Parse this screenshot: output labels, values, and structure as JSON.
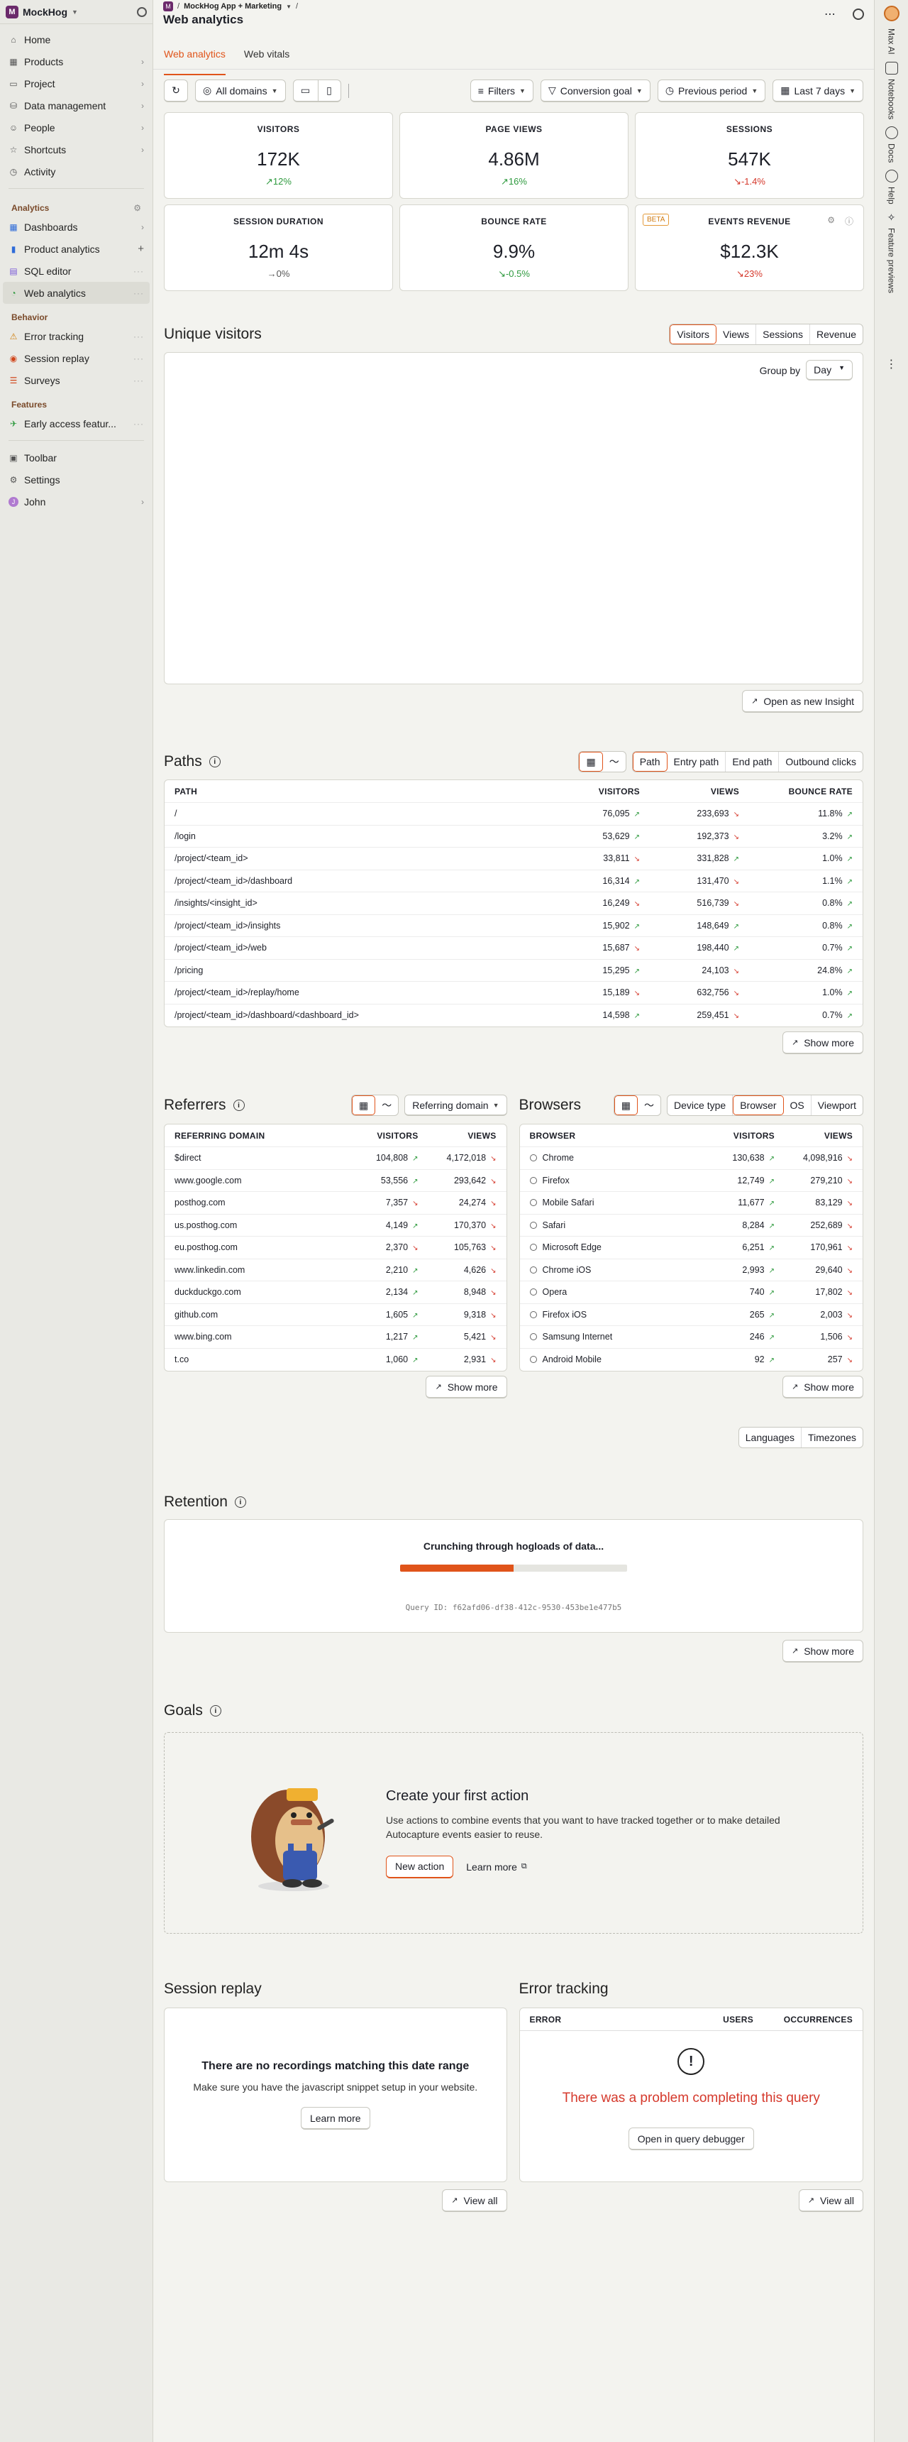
{
  "sidebar": {
    "org": "MockHog",
    "items": [
      {
        "label": "Home",
        "icon": "home-icon"
      },
      {
        "label": "Products",
        "icon": "grid-icon"
      },
      {
        "label": "Project",
        "icon": "folder-icon"
      },
      {
        "label": "Data management",
        "icon": "database-icon"
      },
      {
        "label": "People",
        "icon": "people-icon"
      },
      {
        "label": "Shortcuts",
        "icon": "bookmark-icon"
      },
      {
        "label": "Activity",
        "icon": "clock-icon"
      }
    ],
    "analytics_label": "Analytics",
    "analytics": [
      {
        "label": "Dashboards"
      },
      {
        "label": "Product analytics"
      },
      {
        "label": "SQL editor"
      },
      {
        "label": "Web analytics"
      }
    ],
    "behavior_label": "Behavior",
    "behavior": [
      {
        "label": "Error tracking"
      },
      {
        "label": "Session replay"
      },
      {
        "label": "Surveys"
      }
    ],
    "features_label": "Features",
    "features": [
      {
        "label": "Early access featur..."
      }
    ],
    "bottom": [
      {
        "label": "Toolbar"
      },
      {
        "label": "Settings"
      },
      {
        "label": "John"
      }
    ]
  },
  "rightbar": {
    "items": [
      "Max AI",
      "Notebooks",
      "Docs",
      "Help",
      "Feature previews"
    ]
  },
  "header": {
    "project": "MockHog App + Marketing",
    "title": "Web analytics"
  },
  "tabs": [
    "Web analytics",
    "Web vitals"
  ],
  "filters": {
    "domains": "All domains",
    "filters": "Filters",
    "conversion": "Conversion goal",
    "compare": "Previous period",
    "date": "Last 7 days"
  },
  "metrics": [
    {
      "label": "VISITORS",
      "value": "172K",
      "change": "↗12%",
      "trend": "up"
    },
    {
      "label": "PAGE VIEWS",
      "value": "4.86M",
      "change": "↗16%",
      "trend": "up"
    },
    {
      "label": "SESSIONS",
      "value": "547K",
      "change": "↘-1.4%",
      "trend": "down"
    },
    {
      "label": "SESSION DURATION",
      "value": "12m 4s",
      "change": "→0%",
      "trend": "flat"
    },
    {
      "label": "BOUNCE RATE",
      "value": "9.9%",
      "change": "↘-0.5%",
      "trend": "up"
    },
    {
      "label": "EVENTS REVENUE",
      "value": "$12.3K",
      "change": "↘23%",
      "trend": "down",
      "badge": "BETA"
    }
  ],
  "unique": {
    "title": "Unique visitors",
    "tabs": [
      "Visitors",
      "Views",
      "Sessions",
      "Revenue"
    ],
    "groupby_label": "Group by",
    "groupby_value": "Day",
    "open_insight": "Open as new Insight"
  },
  "paths": {
    "title": "Paths",
    "tabs": [
      "Path",
      "Entry path",
      "End path",
      "Outbound clicks"
    ],
    "headers": [
      "PATH",
      "VISITORS",
      "VIEWS",
      "BOUNCE RATE"
    ],
    "rows": [
      {
        "path": "/",
        "visitors": "76,095",
        "vt": "up",
        "views": "233,693",
        "wt": "down",
        "bounce": "11.8%",
        "bt": "up"
      },
      {
        "path": "/login",
        "visitors": "53,629",
        "vt": "up",
        "views": "192,373",
        "wt": "down",
        "bounce": "3.2%",
        "bt": "up"
      },
      {
        "path": "/project/<team_id>",
        "visitors": "33,811",
        "vt": "down",
        "views": "331,828",
        "wt": "up",
        "bounce": "1.0%",
        "bt": "up"
      },
      {
        "path": "/project/<team_id>/dashboard",
        "visitors": "16,314",
        "vt": "up",
        "views": "131,470",
        "wt": "down",
        "bounce": "1.1%",
        "bt": "up"
      },
      {
        "path": "/insights/<insight_id>",
        "visitors": "16,249",
        "vt": "down",
        "views": "516,739",
        "wt": "down",
        "bounce": "0.8%",
        "bt": "up"
      },
      {
        "path": "/project/<team_id>/insights",
        "visitors": "15,902",
        "vt": "up",
        "views": "148,649",
        "wt": "up",
        "bounce": "0.8%",
        "bt": "up"
      },
      {
        "path": "/project/<team_id>/web",
        "visitors": "15,687",
        "vt": "down",
        "views": "198,440",
        "wt": "up",
        "bounce": "0.7%",
        "bt": "up"
      },
      {
        "path": "/pricing",
        "visitors": "15,295",
        "vt": "up",
        "views": "24,103",
        "wt": "down",
        "bounce": "24.8%",
        "bt": "up"
      },
      {
        "path": "/project/<team_id>/replay/home",
        "visitors": "15,189",
        "vt": "down",
        "views": "632,756",
        "wt": "down",
        "bounce": "1.0%",
        "bt": "up"
      },
      {
        "path": "/project/<team_id>/dashboard/<dashboard_id>",
        "visitors": "14,598",
        "vt": "up",
        "views": "259,451",
        "wt": "down",
        "bounce": "0.7%",
        "bt": "up"
      }
    ],
    "show_more": "Show more"
  },
  "referrers": {
    "title": "Referrers",
    "select": "Referring domain",
    "headers": [
      "REFERRING DOMAIN",
      "VISITORS",
      "VIEWS"
    ],
    "rows": [
      {
        "name": "$direct",
        "visitors": "104,808",
        "vt": "up",
        "views": "4,172,018",
        "wt": "down"
      },
      {
        "name": "www.google.com",
        "visitors": "53,556",
        "vt": "up",
        "views": "293,642",
        "wt": "down"
      },
      {
        "name": "posthog.com",
        "visitors": "7,357",
        "vt": "down",
        "views": "24,274",
        "wt": "down"
      },
      {
        "name": "us.posthog.com",
        "visitors": "4,149",
        "vt": "up",
        "views": "170,370",
        "wt": "down"
      },
      {
        "name": "eu.posthog.com",
        "visitors": "2,370",
        "vt": "down",
        "views": "105,763",
        "wt": "down"
      },
      {
        "name": "www.linkedin.com",
        "visitors": "2,210",
        "vt": "up",
        "views": "4,626",
        "wt": "down"
      },
      {
        "name": "duckduckgo.com",
        "visitors": "2,134",
        "vt": "up",
        "views": "8,948",
        "wt": "down"
      },
      {
        "name": "github.com",
        "visitors": "1,605",
        "vt": "up",
        "views": "9,318",
        "wt": "down"
      },
      {
        "name": "www.bing.com",
        "visitors": "1,217",
        "vt": "up",
        "views": "5,421",
        "wt": "down"
      },
      {
        "name": "t.co",
        "visitors": "1,060",
        "vt": "up",
        "views": "2,931",
        "wt": "down"
      }
    ],
    "show_more": "Show more"
  },
  "browsers": {
    "title": "Browsers",
    "tabs": [
      "Device type",
      "Browser",
      "OS",
      "Viewport"
    ],
    "headers": [
      "BROWSER",
      "VISITORS",
      "VIEWS"
    ],
    "rows": [
      {
        "name": "Chrome",
        "visitors": "130,638",
        "vt": "up",
        "views": "4,098,916",
        "wt": "down"
      },
      {
        "name": "Firefox",
        "visitors": "12,749",
        "vt": "up",
        "views": "279,210",
        "wt": "down"
      },
      {
        "name": "Mobile Safari",
        "visitors": "11,677",
        "vt": "up",
        "views": "83,129",
        "wt": "down"
      },
      {
        "name": "Safari",
        "visitors": "8,284",
        "vt": "up",
        "views": "252,689",
        "wt": "down"
      },
      {
        "name": "Microsoft Edge",
        "visitors": "6,251",
        "vt": "up",
        "views": "170,961",
        "wt": "down"
      },
      {
        "name": "Chrome iOS",
        "visitors": "2,993",
        "vt": "up",
        "views": "29,640",
        "wt": "down"
      },
      {
        "name": "Opera",
        "visitors": "740",
        "vt": "up",
        "views": "17,802",
        "wt": "down"
      },
      {
        "name": "Firefox iOS",
        "visitors": "265",
        "vt": "up",
        "views": "2,003",
        "wt": "down"
      },
      {
        "name": "Samsung Internet",
        "visitors": "246",
        "vt": "up",
        "views": "1,506",
        "wt": "down"
      },
      {
        "name": "Android Mobile",
        "visitors": "92",
        "vt": "up",
        "views": "257",
        "wt": "down"
      }
    ],
    "show_more": "Show more"
  },
  "lang_tabs": [
    "Languages",
    "Timezones"
  ],
  "retention": {
    "title": "Retention",
    "loading": "Crunching through hogloads of data...",
    "progress": 0.5,
    "query_id": "Query ID: f62afd06-df38-412c-9530-453be1e477b5",
    "show_more": "Show more"
  },
  "goals": {
    "title": "Goals",
    "heading": "Create your first action",
    "desc": "Use actions to combine events that you want to have tracked together or to make detailed Autocapture events easier to reuse.",
    "new_action": "New action",
    "learn_more": "Learn more"
  },
  "replay": {
    "title": "Session replay",
    "heading": "There are no recordings matching this date range",
    "desc": "Make sure you have the javascript snippet setup in your website.",
    "learn_more": "Learn more",
    "view_all": "View all"
  },
  "errors": {
    "title": "Error tracking",
    "headers": [
      "ERROR",
      "USERS",
      "OCCURRENCES"
    ],
    "message": "There was a problem completing this query",
    "debug": "Open in query debugger",
    "view_all": "View all"
  }
}
